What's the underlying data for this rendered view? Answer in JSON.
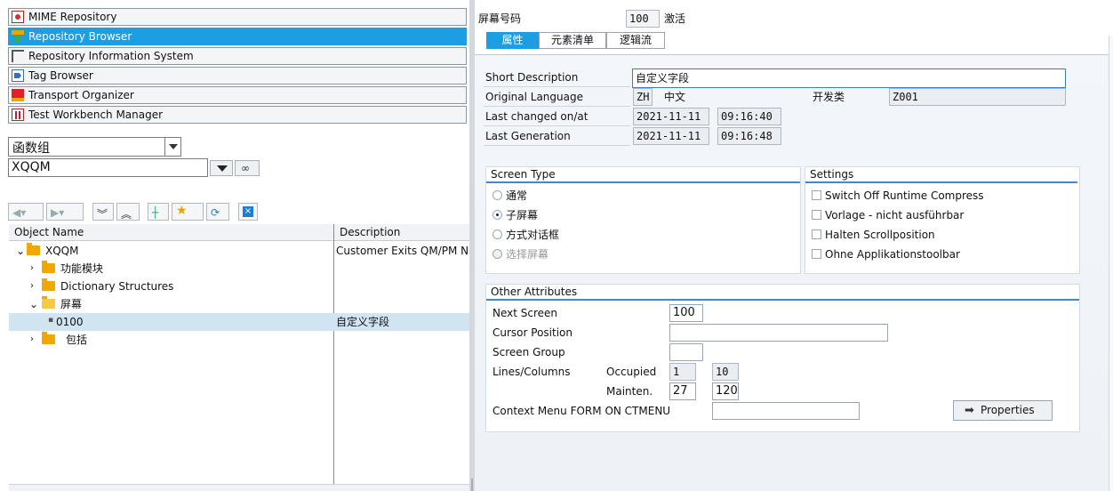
{
  "nav": {
    "items": [
      {
        "label": "MIME Repository",
        "icon": "mime-icon"
      },
      {
        "label": "Repository Browser",
        "icon": "repository-icon"
      },
      {
        "label": "Repository Information System",
        "icon": "info-system-icon"
      },
      {
        "label": "Tag Browser",
        "icon": "tag-icon"
      },
      {
        "label": "Transport Organizer",
        "icon": "truck-icon"
      },
      {
        "label": "Test Workbench Manager",
        "icon": "test-icon"
      }
    ],
    "active_index": 1
  },
  "object_type": {
    "selected": "函数组"
  },
  "object_name": {
    "value": "XQQM"
  },
  "tree": {
    "col_name": "Object Name",
    "col_desc": "Description",
    "rows": [
      {
        "name": "XQQM",
        "desc": "Customer Exits QM/PM Not"
      },
      {
        "name": "功能模块",
        "desc": ""
      },
      {
        "name": "Dictionary Structures",
        "desc": ""
      },
      {
        "name": "屏幕",
        "desc": ""
      },
      {
        "name": "0100",
        "desc": "自定义字段"
      },
      {
        "name": "包括",
        "desc": ""
      }
    ]
  },
  "screen": {
    "label": "屏幕号码",
    "number": "100",
    "status": "激活"
  },
  "tabs": [
    "属性",
    "元素清单",
    "逻辑流"
  ],
  "attributes": {
    "short_desc_label": "Short Description",
    "short_desc_value": "自定义字段",
    "orig_lang_label": "Original Language",
    "orig_lang_code": "ZH",
    "orig_lang_name": "中文",
    "dev_class_label": "开发类",
    "dev_class_value": "Z001",
    "last_changed_label": "Last changed on/at",
    "last_changed_date": "2021-11-11",
    "last_changed_time": "09:16:40",
    "last_gen_label": "Last Generation",
    "last_gen_date": "2021-11-11",
    "last_gen_time": "09:16:48"
  },
  "screen_type": {
    "title": "Screen Type",
    "options": [
      "通常",
      "子屏幕",
      "方式对话框",
      "选择屏幕"
    ],
    "selected": 1
  },
  "settings": {
    "title": "Settings",
    "options": [
      "Switch Off Runtime Compress",
      "Vorlage - nicht ausführbar",
      "Halten Scrollposition",
      "Ohne Applikationstoolbar"
    ]
  },
  "other": {
    "title": "Other Attributes",
    "next_screen_label": "Next Screen",
    "next_screen_value": "100",
    "cursor_label": "Cursor Position",
    "cursor_value": "",
    "group_label": "Screen Group",
    "group_value": "",
    "lines_label": "Lines/Columns",
    "occupied_label": "Occupied",
    "occupied_lines": "1",
    "occupied_cols": "10",
    "mainten_label": "Mainten.",
    "mainten_lines": "27",
    "mainten_cols": "120",
    "ctx_label": "Context Menu FORM ON CTMENU",
    "ctx_value": "",
    "properties_btn": "Properties"
  },
  "colors": {
    "accent": "#1d9ee2",
    "folder": "#f0a800",
    "selection": "#d0e4f2"
  }
}
